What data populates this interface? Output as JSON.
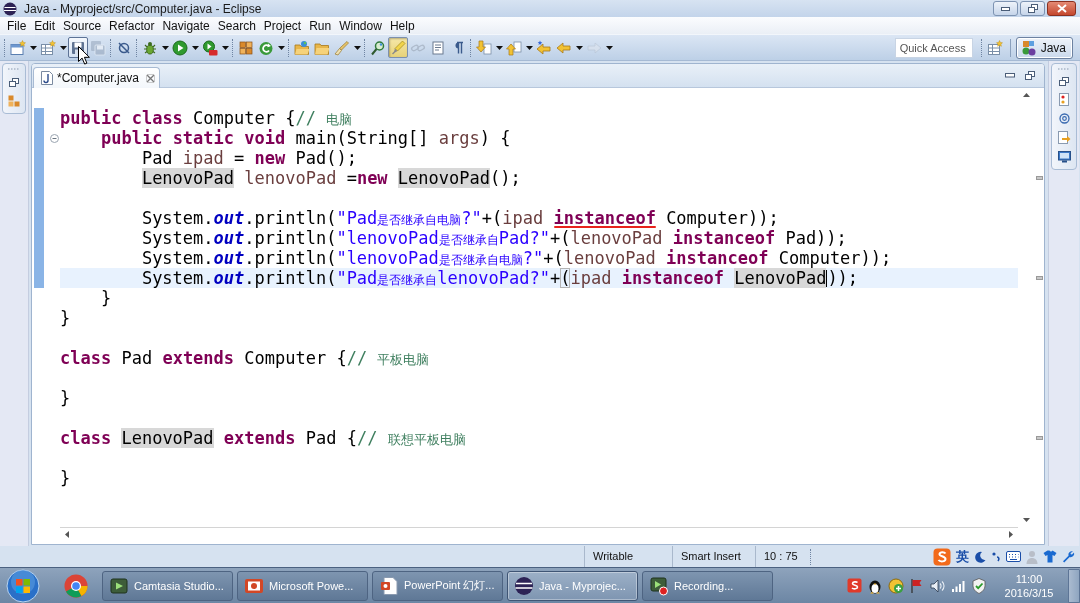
{
  "window": {
    "title": "Java - Myproject/src/Computer.java - Eclipse"
  },
  "menu": [
    "File",
    "Edit",
    "Source",
    "Refactor",
    "Navigate",
    "Search",
    "Project",
    "Run",
    "Window",
    "Help"
  ],
  "toolbar": {
    "groups": [
      {
        "buttons": [
          {
            "kind": "new",
            "dropdown": true,
            "pressed": false,
            "hovered": false,
            "disabled": false
          },
          {
            "kind": "newitem",
            "dropdown": true,
            "pressed": false,
            "hovered": false,
            "disabled": false
          },
          {
            "kind": "save",
            "dropdown": false,
            "pressed": false,
            "hovered": true,
            "disabled": false
          },
          {
            "kind": "saveall",
            "dropdown": false,
            "pressed": false,
            "hovered": false,
            "disabled": true
          }
        ]
      },
      {
        "buttons": [
          {
            "kind": "skip",
            "dropdown": false,
            "pressed": false,
            "hovered": false,
            "disabled": false
          }
        ]
      },
      {
        "buttons": [
          {
            "kind": "debug",
            "dropdown": true,
            "pressed": false,
            "hovered": false,
            "disabled": false
          },
          {
            "kind": "run",
            "dropdown": true,
            "pressed": false,
            "hovered": false,
            "disabled": false
          },
          {
            "kind": "external",
            "dropdown": true,
            "pressed": false,
            "hovered": false,
            "disabled": false
          }
        ]
      },
      {
        "buttons": [
          {
            "kind": "package",
            "dropdown": false,
            "pressed": false,
            "hovered": false,
            "disabled": false
          },
          {
            "kind": "refresh",
            "dropdown": true,
            "pressed": false,
            "hovered": false,
            "disabled": false
          }
        ]
      },
      {
        "buttons": [
          {
            "kind": "openfolder",
            "dropdown": false,
            "pressed": false,
            "hovered": false,
            "disabled": false
          },
          {
            "kind": "folder",
            "dropdown": false,
            "pressed": false,
            "hovered": false,
            "disabled": false
          },
          {
            "kind": "brush",
            "dropdown": true,
            "pressed": false,
            "hovered": false,
            "disabled": false
          }
        ]
      },
      {
        "buttons": [
          {
            "kind": "pin",
            "dropdown": false,
            "pressed": false,
            "hovered": false,
            "disabled": false
          },
          {
            "kind": "highlight",
            "dropdown": false,
            "pressed": true,
            "hovered": false,
            "disabled": false
          },
          {
            "kind": "links",
            "dropdown": false,
            "pressed": false,
            "hovered": false,
            "disabled": true
          },
          {
            "kind": "block",
            "dropdown": false,
            "pressed": false,
            "hovered": false,
            "disabled": false
          },
          {
            "kind": "pilcrow",
            "dropdown": false,
            "pressed": false,
            "hovered": false,
            "disabled": false
          }
        ]
      },
      {
        "buttons": [
          {
            "kind": "down",
            "dropdown": true,
            "pressed": false,
            "hovered": false,
            "disabled": false
          },
          {
            "kind": "up",
            "dropdown": true,
            "pressed": false,
            "hovered": false,
            "disabled": false
          },
          {
            "kind": "lastedit",
            "dropdown": false,
            "pressed": false,
            "hovered": false,
            "disabled": false
          },
          {
            "kind": "back",
            "dropdown": true,
            "pressed": false,
            "hovered": false,
            "disabled": false
          },
          {
            "kind": "forward",
            "dropdown": true,
            "pressed": false,
            "hovered": false,
            "disabled": true
          }
        ]
      }
    ],
    "quick_access": {
      "placeholder": "Quick Access"
    },
    "perspectives": [
      {
        "label": "Java",
        "selected": true
      }
    ]
  },
  "editor": {
    "tabs": [
      {
        "label": "*Computer.java",
        "selected": true
      }
    ],
    "lines": [
      {
        "current": false,
        "changed": false,
        "fold": false
      },
      {
        "current": false,
        "changed": true,
        "fold": false,
        "tokens": [
          {
            "text": "public ",
            "kind": "keyword"
          },
          {
            "text": "class ",
            "kind": "keyword"
          },
          {
            "text": "Computer {",
            "kind": "plain"
          },
          {
            "text": "// 电脑",
            "kind": "comment"
          }
        ]
      },
      {
        "current": false,
        "changed": true,
        "fold": true,
        "tokens": [
          {
            "text": "    public ",
            "kind": "keyword"
          },
          {
            "text": "static ",
            "kind": "keyword"
          },
          {
            "text": "void ",
            "kind": "keyword"
          },
          {
            "text": "main(String[] ",
            "kind": "plain"
          },
          {
            "text": "args",
            "kind": "local"
          },
          {
            "text": ") {",
            "kind": "plain"
          }
        ]
      },
      {
        "current": false,
        "changed": true,
        "fold": false,
        "tokens": [
          {
            "text": "        Pad ",
            "kind": "plain"
          },
          {
            "text": "ipad",
            "kind": "local"
          },
          {
            "text": " = ",
            "kind": "plain"
          },
          {
            "text": "new ",
            "kind": "keyword"
          },
          {
            "text": "Pad();",
            "kind": "plain"
          }
        ]
      },
      {
        "current": false,
        "changed": true,
        "fold": false,
        "tokens": [
          {
            "text": "        LenovoPad ",
            "kind": "occurrence"
          },
          {
            "text": "lenovoPad ",
            "kind": "local"
          },
          {
            "text": "=",
            "kind": "plain"
          },
          {
            "text": "new ",
            "kind": "keyword"
          },
          {
            "text": "LenovoPad",
            "kind": "occurrence"
          },
          {
            "text": "();",
            "kind": "plain"
          }
        ]
      },
      {
        "current": false,
        "changed": true,
        "fold": false
      },
      {
        "current": false,
        "changed": true,
        "fold": false,
        "tokens": [
          {
            "text": "        System.",
            "kind": "plain"
          },
          {
            "text": "out",
            "kind": "field"
          },
          {
            "text": ".println(",
            "kind": "plain"
          },
          {
            "text": "\"Pad是否继承自电脑?\"",
            "kind": "string"
          },
          {
            "text": "+(",
            "kind": "plain"
          },
          {
            "text": "ipad ",
            "kind": "local"
          },
          {
            "text": "instanceof ",
            "kind": "annotated"
          },
          {
            "text": "Computer));",
            "kind": "plain"
          }
        ]
      },
      {
        "current": false,
        "changed": true,
        "fold": false,
        "tokens": [
          {
            "text": "        System.",
            "kind": "plain"
          },
          {
            "text": "out",
            "kind": "field"
          },
          {
            "text": ".println(",
            "kind": "plain"
          },
          {
            "text": "\"lenovoPad是否继承自Pad?\"",
            "kind": "string"
          },
          {
            "text": "+(",
            "kind": "plain"
          },
          {
            "text": "lenovoPad ",
            "kind": "local"
          },
          {
            "text": "instanceof ",
            "kind": "keyword"
          },
          {
            "text": "Pad));",
            "kind": "plain"
          }
        ]
      },
      {
        "current": false,
        "changed": true,
        "fold": false,
        "tokens": [
          {
            "text": "        System.",
            "kind": "plain"
          },
          {
            "text": "out",
            "kind": "field"
          },
          {
            "text": ".println(",
            "kind": "plain"
          },
          {
            "text": "\"lenovoPad是否继承自电脑?\"",
            "kind": "string"
          },
          {
            "text": "+(",
            "kind": "plain"
          },
          {
            "text": "lenovoPad ",
            "kind": "local"
          },
          {
            "text": "instanceof ",
            "kind": "keyword"
          },
          {
            "text": "Computer));",
            "kind": "plain"
          }
        ]
      },
      {
        "current": true,
        "changed": true,
        "fold": false,
        "tokens": [
          {
            "text": "        System.",
            "kind": "plain"
          },
          {
            "text": "out",
            "kind": "field"
          },
          {
            "text": ".println(",
            "kind": "plain"
          },
          {
            "text": "\"Pad是否继承自lenovoPad?\"",
            "kind": "string"
          },
          {
            "text": "+",
            "kind": "plain"
          },
          {
            "text": "(",
            "kind": "bracket"
          },
          {
            "text": "ipad ",
            "kind": "local"
          },
          {
            "text": "instanceof ",
            "kind": "keyword"
          },
          {
            "text": "LenovoPad",
            "kind": "occurrence"
          },
          {
            "kind": "caret"
          },
          {
            "text": "));",
            "kind": "plain"
          }
        ]
      },
      {
        "current": false,
        "changed": false,
        "fold": false,
        "tokens": [
          {
            "text": "    }",
            "kind": "plain"
          }
        ]
      },
      {
        "current": false,
        "changed": false,
        "fold": false,
        "tokens": [
          {
            "text": "}",
            "kind": "plain"
          }
        ]
      },
      {
        "current": false,
        "changed": false,
        "fold": false
      },
      {
        "current": false,
        "changed": false,
        "fold": false,
        "tokens": [
          {
            "text": "class ",
            "kind": "keyword"
          },
          {
            "text": "Pad ",
            "kind": "plain"
          },
          {
            "text": "extends ",
            "kind": "keyword"
          },
          {
            "text": "Computer {",
            "kind": "plain"
          },
          {
            "text": "// 平板电脑",
            "kind": "comment"
          }
        ]
      },
      {
        "current": false,
        "changed": false,
        "fold": false
      },
      {
        "current": false,
        "changed": false,
        "fold": false,
        "tokens": [
          {
            "text": "}",
            "kind": "plain"
          }
        ]
      },
      {
        "current": false,
        "changed": false,
        "fold": false
      },
      {
        "current": false,
        "changed": false,
        "fold": false,
        "tokens": [
          {
            "text": "class ",
            "kind": "keyword"
          },
          {
            "text": "LenovoPad ",
            "kind": "occurrence"
          },
          {
            "text": "extends ",
            "kind": "keyword"
          },
          {
            "text": "Pad {",
            "kind": "plain"
          },
          {
            "text": "// 联想平板电脑",
            "kind": "comment"
          }
        ]
      },
      {
        "current": false,
        "changed": false,
        "fold": false
      },
      {
        "current": false,
        "changed": false,
        "fold": false,
        "tokens": [
          {
            "text": "}",
            "kind": "plain"
          }
        ]
      }
    ]
  },
  "status_bar": {
    "fields": [
      "Writable",
      "Smart Insert",
      "10 : 75"
    ]
  },
  "ime_bar": {
    "mode": "英"
  },
  "taskbar": {
    "tasks": [
      {
        "label": "Camtasia Studio...",
        "kind": "camtasia",
        "selected": false
      },
      {
        "label": "Microsoft Powe...",
        "kind": "powerpoint",
        "selected": false
      },
      {
        "label": "PowerPoint 幻灯...",
        "kind": "slides",
        "selected": false
      },
      {
        "label": "Java - Myprojec...",
        "kind": "eclipse",
        "selected": true
      },
      {
        "label": "Recording...",
        "kind": "recorder",
        "selected": false
      }
    ],
    "clock": {
      "time": "11:00",
      "date": "2016/3/15"
    }
  }
}
